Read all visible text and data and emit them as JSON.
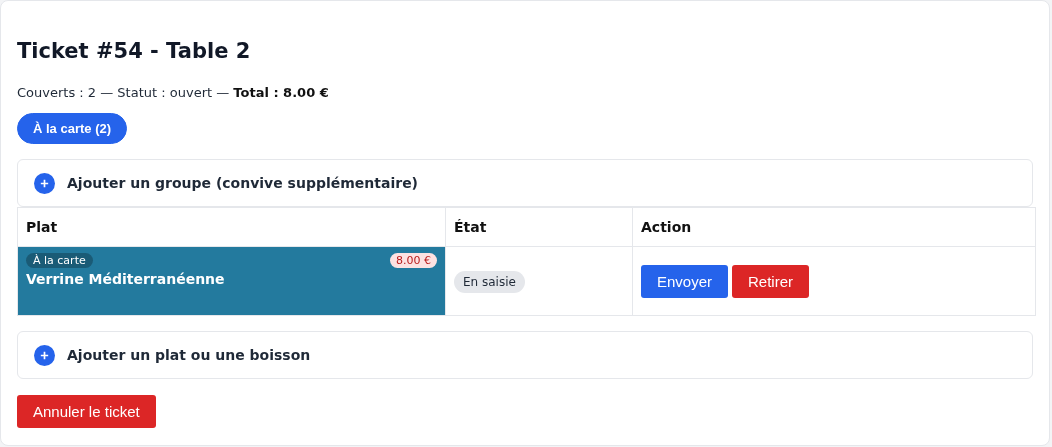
{
  "title": "Ticket #54 - Table 2",
  "summary": "Couverts : 2 — Statut : ouvert — **Total : 8.00 €**",
  "groups": [
    {
      "label": "À la carte (2)",
      "selected": true
    }
  ],
  "add_group": "Ajouter un groupe (convive supplémentaire)",
  "table": {
    "columns": [
      "Plat",
      "État",
      "Action"
    ],
    "rows": [
      {
        "tag": "À la carte",
        "price": "8.00 €",
        "name": "Verrine Méditerranéenne",
        "color": "#237a9e",
        "status": "En saisie",
        "actions": [
          {
            "label": "Envoyer",
            "kind": "primary"
          },
          {
            "label": "Retirer",
            "kind": "danger"
          }
        ]
      }
    ]
  },
  "add_item": "Ajouter un plat ou une boisson",
  "cancel_button": "Annuler le ticket"
}
